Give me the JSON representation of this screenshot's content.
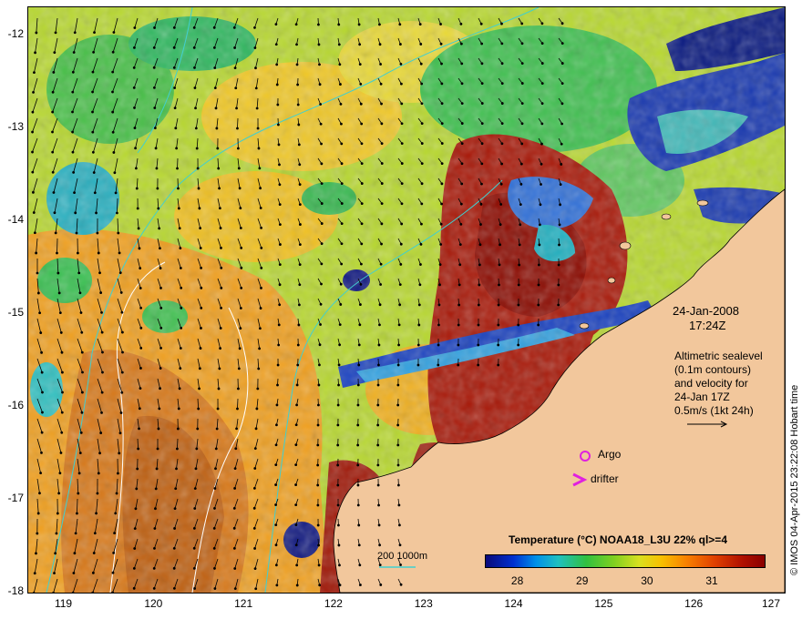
{
  "title_date": "24-Jan-2008",
  "title_time": "17:24Z",
  "altimetry_note": [
    "Altimetric sealevel",
    "(0.1m contours)",
    "and velocity for",
    "24-Jan 17Z",
    "0.5m/s (1kt 24h)"
  ],
  "legend_argo": "Argo",
  "legend_drifter": "drifter",
  "depth_legend": "200  1000m",
  "colorbar": {
    "title": "Temperature (°C) NOAA18_L3U 22% ql>=4",
    "ticks": [
      "28",
      "29",
      "30",
      "31"
    ],
    "tick_values": [
      28,
      29,
      30,
      31
    ],
    "min": 27.5,
    "max": 31.8
  },
  "axes": {
    "x_ticks": [
      "119",
      "120",
      "121",
      "122",
      "123",
      "124",
      "125",
      "126",
      "127"
    ],
    "y_ticks": [
      "-12",
      "-13",
      "-14",
      "-15",
      "-16",
      "-17",
      "-18"
    ],
    "x_range": [
      118.6,
      127
    ],
    "y_range": [
      -18,
      -11.7
    ]
  },
  "credit": "© IMOS 04-Apr-2015 23:22:08 Hobart time",
  "colors": {
    "land": "#f2c79c",
    "argo": "#e020e0",
    "drifter": "#e020e0",
    "depth_contour": "#40d0d0",
    "sealevel_contour": "#ffffff"
  }
}
